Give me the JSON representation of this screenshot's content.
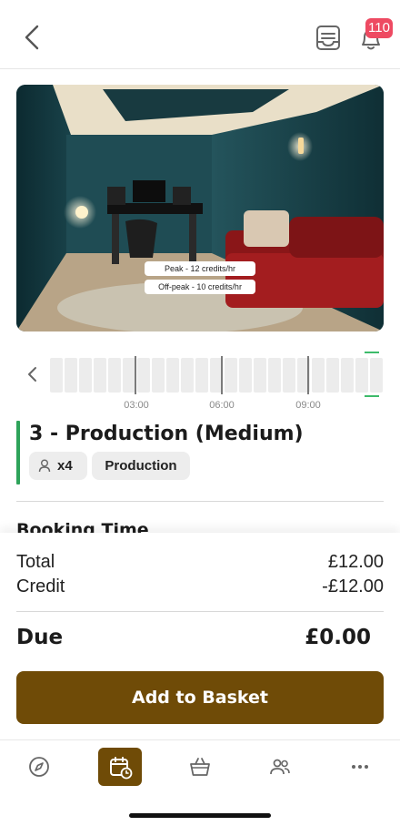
{
  "header": {
    "back_icon": "chevron-left-icon",
    "receipt_icon": "receipt-icon",
    "bell_icon": "bell-icon",
    "notification_count": "110"
  },
  "hero": {
    "peak_label": "Peak - 12 credits/hr",
    "offpeak_label": "Off-peak - 10 credits/hr"
  },
  "timeline": {
    "labels": [
      "03:00",
      "06:00",
      "09:00"
    ]
  },
  "room": {
    "title": "3 - Production (Medium)",
    "capacity": "x4",
    "type": "Production",
    "accent_color": "#2ea35a"
  },
  "section": {
    "booking_time": "Booking Time"
  },
  "summary": {
    "total_label": "Total",
    "total_value": "£12.00",
    "credit_label": "Credit",
    "credit_value": "-£12.00",
    "due_label": "Due",
    "due_value": "£0.00",
    "add_button": "Add to Basket",
    "button_color": "#6f4b07"
  },
  "tabbar": {
    "items": [
      "compass-icon",
      "calendar-clock-icon",
      "basket-icon",
      "people-icon",
      "more-icon"
    ],
    "active": "calendar-clock-icon"
  }
}
